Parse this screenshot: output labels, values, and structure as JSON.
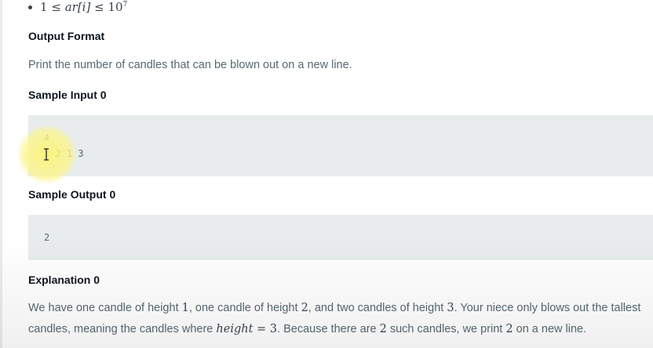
{
  "constraint": {
    "lower": "1",
    "le1": "≤",
    "var": "ar",
    "index": "[i]",
    "le2": "≤",
    "base": "10",
    "exp": "7"
  },
  "output_format": {
    "heading": "Output Format",
    "text": "Print the number of candles that can be blown out on a new line."
  },
  "sample_input": {
    "heading": "Sample Input 0",
    "lines": [
      "4",
      "3 2 1 3"
    ]
  },
  "sample_output": {
    "heading": "Sample Output 0",
    "lines": [
      "2"
    ]
  },
  "explanation": {
    "heading": "Explanation 0",
    "p1": "We have one candle of height ",
    "v1": "1",
    "p2": ", one candle of height ",
    "v2": "2",
    "p3": ", and two candles of height ",
    "v3": "3",
    "p4": ". Your niece only blows out the tallest candles, meaning the candles where ",
    "eq_var": "height",
    "eq_sign": " = ",
    "eq_val": "3",
    "p5": ". Because there are ",
    "v4": "2",
    "p6": " such candles, we print ",
    "v5": "2",
    "p7": " on a new line."
  },
  "colors": {
    "highlight": "#fcf578",
    "codebox_bg": "#e8ecec",
    "heading": "#0e141e",
    "body_text": "#576871"
  },
  "icons": {
    "cursor": "text-cursor-icon"
  }
}
